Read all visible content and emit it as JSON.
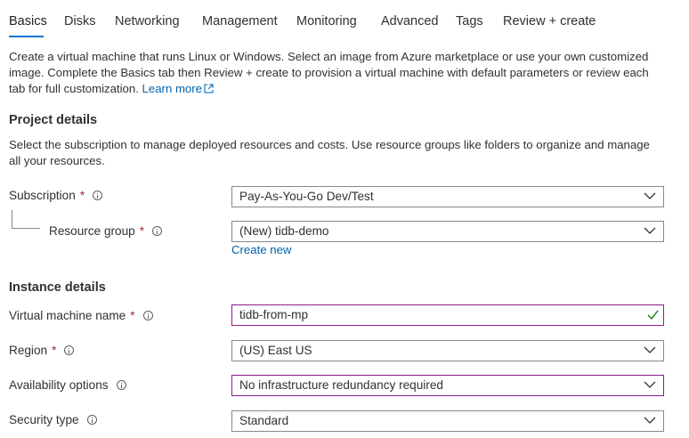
{
  "tabs": [
    {
      "label": "Basics"
    },
    {
      "label": "Disks"
    },
    {
      "label": "Networking"
    },
    {
      "label": "Management"
    },
    {
      "label": "Monitoring"
    },
    {
      "label": "Advanced"
    },
    {
      "label": "Tags"
    },
    {
      "label": "Review + create"
    }
  ],
  "active_tab": "Basics",
  "intro": {
    "line1": "Create a virtual machine that runs Linux or Windows. Select an image from Azure marketplace or use your own customized",
    "line2": "image. Complete the Basics tab then Review + create to provision a virtual machine with default parameters or review each",
    "line3": "tab for full customization.",
    "learn_more": "Learn more"
  },
  "project": {
    "heading": "Project details",
    "desc_line1": "Select the subscription to manage deployed resources and costs. Use resource groups like folders to organize and manage",
    "desc_line2": "all your resources.",
    "subscription": {
      "label": "Subscription",
      "required": "*",
      "value": "Pay-As-You-Go Dev/Test"
    },
    "resource_group": {
      "label": "Resource group",
      "required": "*",
      "value": "(New) tidb-demo",
      "create_new": "Create new"
    }
  },
  "instance": {
    "heading": "Instance details",
    "vm_name": {
      "label": "Virtual machine name",
      "required": "*",
      "value": "tidb-from-mp"
    },
    "region": {
      "label": "Region",
      "required": "*",
      "value": "(US) East US"
    },
    "availability": {
      "label": "Availability options",
      "value": "No infrastructure redundancy required"
    },
    "security": {
      "label": "Security type",
      "value": "Standard"
    }
  },
  "icons": {
    "info": "info-icon",
    "dropdown": "chevron-down-icon",
    "valid": "checkmark-icon",
    "external": "external-link-icon"
  },
  "colors": {
    "accent": "#0078d4",
    "link": "#0062ad",
    "required": "#a4262c",
    "focus_border": "#8c1d8c",
    "valid": "#107c10"
  }
}
